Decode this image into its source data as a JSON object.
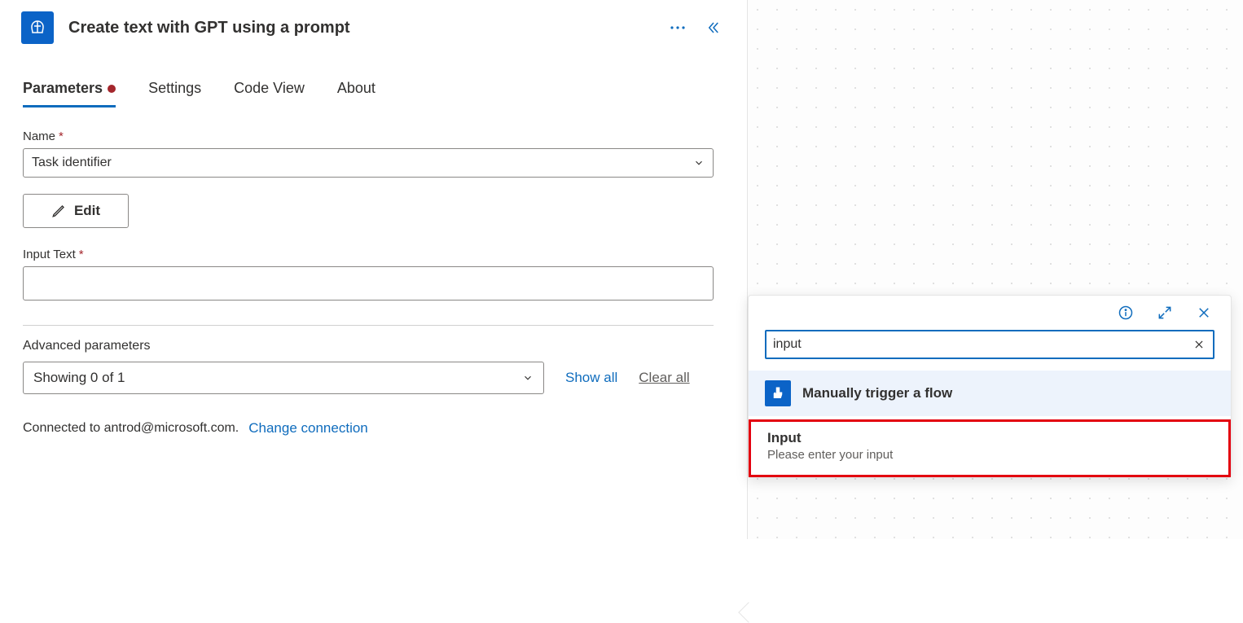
{
  "panel": {
    "title": "Create text with GPT using a prompt",
    "tabs": [
      "Parameters",
      "Settings",
      "Code View",
      "About"
    ],
    "active_tab": 0
  },
  "fields": {
    "name_label": "Name",
    "name_value": "Task identifier",
    "edit_button": "Edit",
    "input_text_label": "Input Text",
    "input_text_value": ""
  },
  "advanced": {
    "heading": "Advanced parameters",
    "select_value": "Showing 0 of 1",
    "show_all": "Show all",
    "clear_all": "Clear all"
  },
  "connection": {
    "prefix": "Connected to antrod@microsoft.com.",
    "change": "Change connection"
  },
  "popup": {
    "search_value": "input",
    "section_title": "Manually trigger a flow",
    "result_title": "Input",
    "result_desc": "Please enter your input"
  }
}
